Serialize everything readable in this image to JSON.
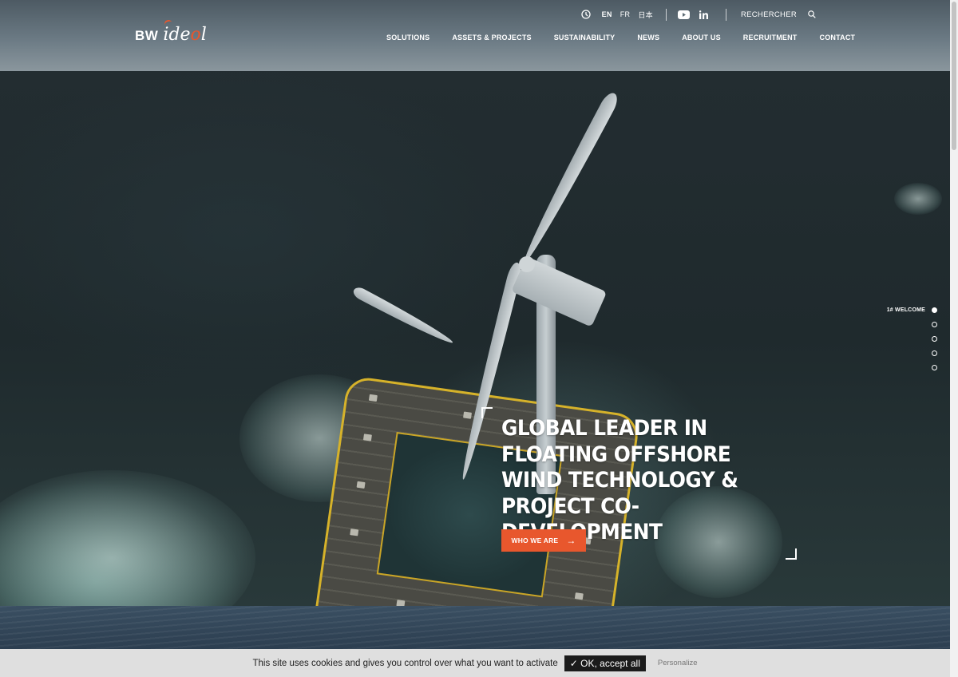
{
  "brand": {
    "bw": "BW",
    "ideol_main": "ide",
    "ideol_accent": "o",
    "ideol_end": "l"
  },
  "topbar": {
    "languages": [
      "EN",
      "FR",
      "日本"
    ],
    "search_label": "RECHERCHER",
    "icons": [
      "clock-icon",
      "youtube-icon",
      "linkedin-icon",
      "search-icon"
    ]
  },
  "nav": {
    "items": [
      "SOLUTIONS",
      "ASSETS & PROJECTS",
      "SUSTAINABILITY",
      "NEWS",
      "ABOUT US",
      "RECRUITMENT",
      "CONTACT"
    ]
  },
  "hero": {
    "headline": "GLOBAL LEADER IN FLOATING OFFSHORE WIND TECHNOLOGY & PROJECT CO-DEVELOPMENT",
    "cta_label": "WHO WE ARE",
    "slide_label": "1# WELCOME",
    "slide_count": 5,
    "active_slide": 1
  },
  "cookie": {
    "message": "This site uses cookies and gives you control over what you want to activate",
    "accept_label": "✓ OK, accept all",
    "personalize_label": "Personalize"
  },
  "colors": {
    "accent": "#e8572d",
    "cookie_bg": "#dfdfdf"
  }
}
